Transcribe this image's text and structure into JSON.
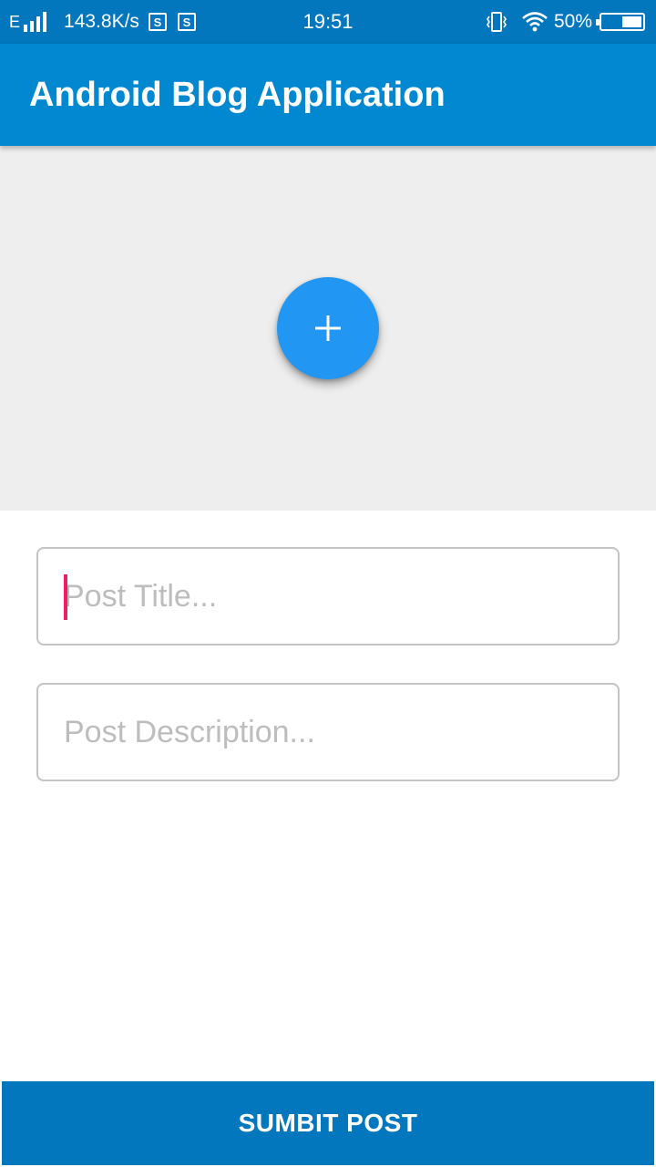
{
  "status_bar": {
    "network_type": "E",
    "speed": "143.8K/s",
    "s_icon_label": "S",
    "time": "19:51",
    "battery_percent": "50%",
    "battery_level": 0.5
  },
  "app_bar": {
    "title": "Android Blog Application"
  },
  "image_picker": {
    "add_icon": "plus-icon",
    "background": "#eeeeee",
    "fab_color": "#2196f3"
  },
  "form": {
    "title_placeholder": "Post Title...",
    "description_placeholder": "Post Description...",
    "title_value": "",
    "description_value": ""
  },
  "submit": {
    "label": "SUMBIT POST",
    "color": "#0277bd"
  },
  "colors": {
    "primary": "#0288d1",
    "primary_dark": "#0277bd",
    "accent": "#e91e63"
  }
}
